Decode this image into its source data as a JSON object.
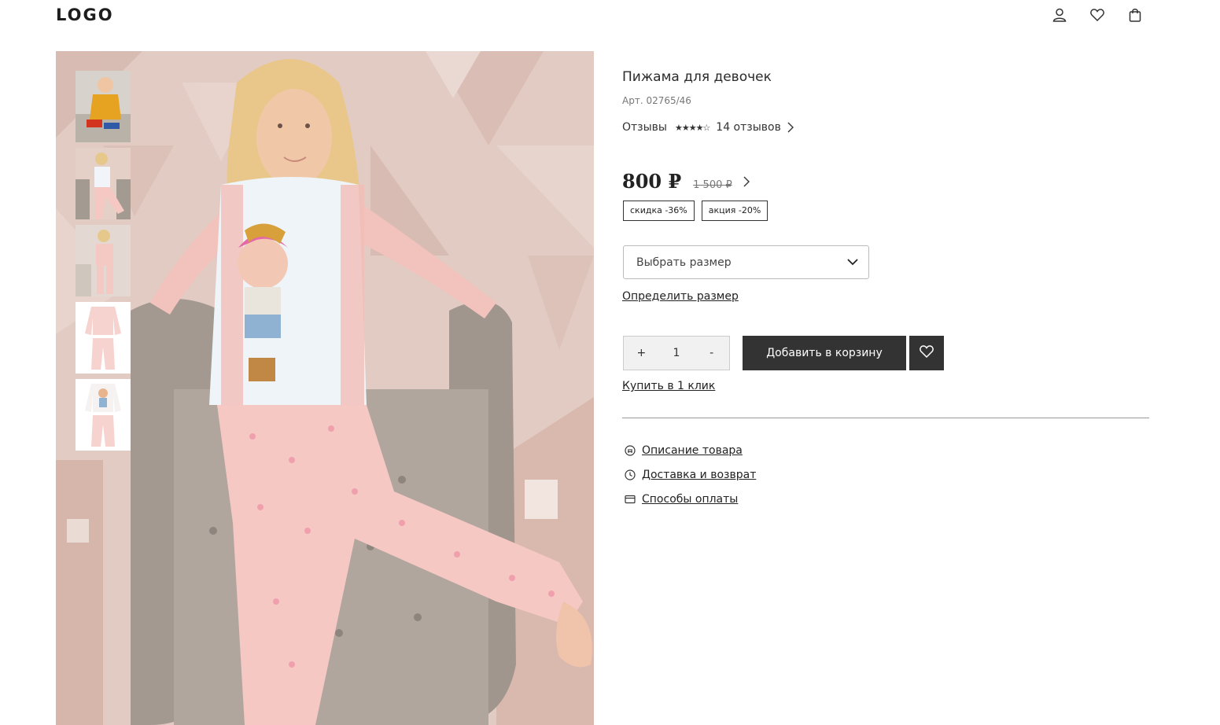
{
  "header": {
    "logo": "LOGO",
    "icons": [
      "user-icon",
      "heart-icon",
      "bag-icon"
    ]
  },
  "gallery": {
    "thumbnails": [
      "thumbnail-1",
      "thumbnail-2",
      "thumbnail-3",
      "thumbnail-4",
      "thumbnail-5"
    ]
  },
  "product": {
    "title": "Пижама для девочек",
    "sku": "Арт. 02765/46",
    "reviews_label": "Отзывы",
    "rating_stars": "★★★★☆",
    "reviews_count": "14 отзывов",
    "price": "800 ₽",
    "old_price": "1 500 ₽",
    "badges": [
      "скидка -36%",
      "акция -20%"
    ],
    "size_placeholder": "Выбрать размер",
    "size_link": "Определить размер",
    "qty_plus": "+",
    "qty_value": "1",
    "qty_minus": "-",
    "add_to_cart": "Добавить в корзину",
    "buy_one_click": "Купить в 1 клик"
  },
  "info_links": [
    {
      "icon": "description-icon",
      "label": "Описание товара"
    },
    {
      "icon": "clock-icon",
      "label": "Доставка и возврат"
    },
    {
      "icon": "card-icon",
      "label": "Способы оплаты"
    }
  ],
  "colors": {
    "primary_button": "#333333",
    "text": "#2b2b2b",
    "muted": "#777777",
    "photo_bg": "#e4cdc6"
  }
}
